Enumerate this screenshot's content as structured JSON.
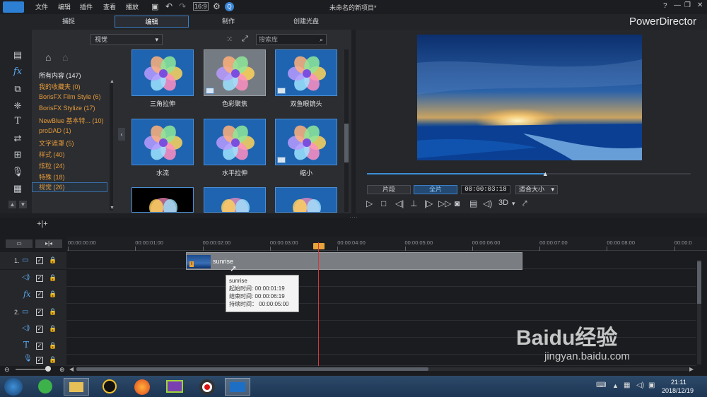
{
  "menu": [
    "文件",
    "编辑",
    "插件",
    "查看",
    "播放"
  ],
  "window_title": "未命名的新项目*",
  "modes": [
    "捕捉",
    "编辑",
    "制作",
    "创建光盘"
  ],
  "brand": "PowerDirector",
  "library": {
    "dropdown": "视觉",
    "search_placeholder": "搜索库",
    "categories": [
      {
        "label": "所有内容 (147)",
        "style": "white"
      },
      {
        "label": "我的收藏夹  (0)",
        "style": "orange"
      },
      {
        "label": "BorisFX Film Style  (6)",
        "style": "orange"
      },
      {
        "label": "BorisFX Stylize  (17)",
        "style": "orange"
      },
      {
        "label": "NewBlue 基本特...  (10)",
        "style": "orange"
      },
      {
        "label": "proDAD  (1)",
        "style": "orange"
      },
      {
        "label": "文字遮罩  (5)",
        "style": "orange"
      },
      {
        "label": "样式  (40)",
        "style": "orange"
      },
      {
        "label": "炫粒  (24)",
        "style": "orange"
      },
      {
        "label": "特殊  (18)",
        "style": "orange"
      },
      {
        "label": "视觉  (26)",
        "style": "selected"
      }
    ],
    "effects": [
      "三角拉伸",
      "色彩聚焦",
      "双鱼眼镜头",
      "水流",
      "水平拉伸",
      "缩小"
    ]
  },
  "preview": {
    "segment_label": "片段",
    "full_label": "全片",
    "timecode": "00:00:03:18",
    "fit_label": "适合大小",
    "mode_3d": "3D",
    "progress": 0.55
  },
  "timeline": {
    "ticks": [
      "00:00:00:00",
      "00:00:01:00",
      "00:00:02:00",
      "00:00:03:00",
      "00:00:04:00",
      "00:00:05:00",
      "00:00:06:00",
      "00:00:07:00",
      "00:00:08:00",
      "00:00:0"
    ],
    "tracks": [
      "1.",
      "",
      "",
      "2.",
      "",
      "",
      ""
    ],
    "clip_name": "sunrise",
    "tooltip": {
      "name": "sunrise",
      "start": "起始时间: 00:00:01:19",
      "end": "结束时间: 00:00:06:19",
      "duration": "持续时间：  00:00:05:00"
    }
  },
  "taskbar": {
    "time": "21:11",
    "date": "2018/12/19"
  },
  "watermark": {
    "logo": "Baidu经验",
    "url": "jingyan.baidu.com"
  }
}
